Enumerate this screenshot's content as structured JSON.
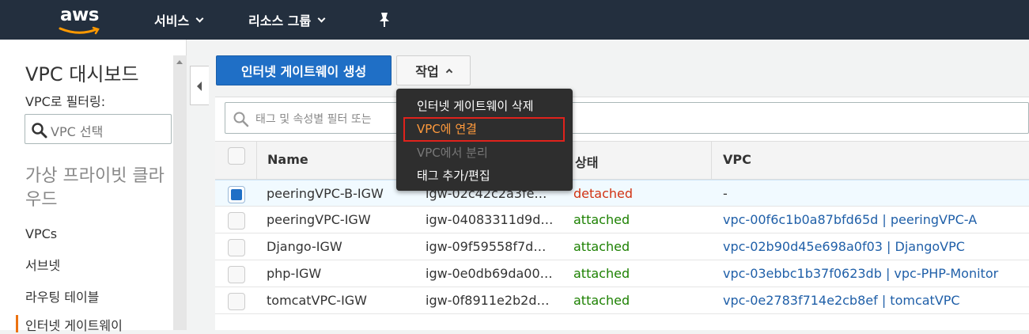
{
  "topnav": {
    "logo": "aws",
    "services": "서비스",
    "resource_groups": "리소스 그룹",
    "pin_icon": "pushpin-icon"
  },
  "sidebar": {
    "title": "VPC 대시보드",
    "filter_label": "VPC로 필터링:",
    "filter_placeholder": "VPC 선택",
    "group_heading": "가상 프라이빗 클라우드",
    "items": [
      {
        "label": "VPCs"
      },
      {
        "label": "서브넷"
      },
      {
        "label": "라우팅 테이블"
      },
      {
        "label": "인터넷 게이트웨이",
        "active": true
      }
    ]
  },
  "toolbar": {
    "create_label": "인터넷 게이트웨이 생성",
    "actions_label": "작업"
  },
  "actions_menu": {
    "items": [
      {
        "label": "인터넷 게이트웨이 삭제",
        "state": "enabled"
      },
      {
        "label": "VPC에 연결",
        "state": "highlighted"
      },
      {
        "label": "VPC에서 분리",
        "state": "disabled"
      },
      {
        "label": "태그 추가/편집",
        "state": "enabled"
      }
    ]
  },
  "filter": {
    "placeholder": "태그 및 속성별 필터 또는"
  },
  "table": {
    "columns": [
      "Name",
      "상태",
      "VPC"
    ],
    "rows": [
      {
        "name": "peeringVPC-B-IGW",
        "id": "igw-02c42c2a3fe…",
        "state": "detached",
        "vpc": "-",
        "selected": true
      },
      {
        "name": "peeringVPC-IGW",
        "id": "igw-04083311d9d…",
        "state": "attached",
        "vpc": "vpc-00f6c1b0a87bfd65d | peeringVPC-A",
        "selected": false
      },
      {
        "name": "Django-IGW",
        "id": "igw-09f59558f7dd…",
        "state": "attached",
        "vpc": "vpc-02b90d45e698a0f03 | DjangoVPC",
        "selected": false
      },
      {
        "name": "php-IGW",
        "id": "igw-0e0db69da00…",
        "state": "attached",
        "vpc": "vpc-03ebbc1b37f0623db | vpc-PHP-Monitor",
        "selected": false
      },
      {
        "name": "tomcatVPC-IGW",
        "id": "igw-0f8911e2b2dd…",
        "state": "attached",
        "vpc": "vpc-0e2783f714e2cb8ef | tomcatVPC",
        "selected": false
      }
    ]
  },
  "colors": {
    "nav_bg": "#232f3e",
    "primary": "#1f6fc6",
    "attached": "#1d8102",
    "detached": "#d13212",
    "menu_highlight": "#ff9a3c",
    "annotation_box": "#e0221c",
    "sidebar_active": "#ec7211"
  }
}
